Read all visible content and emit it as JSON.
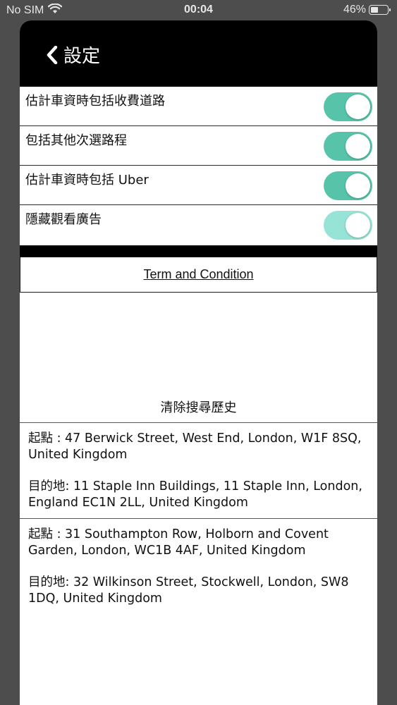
{
  "status_bar": {
    "carrier": "No SIM",
    "time": "00:04",
    "battery_percent": "46%",
    "battery_level": 0.46
  },
  "header": {
    "back_label": "設定"
  },
  "settings": [
    {
      "label": "估計車資時包括收費道路",
      "on": true
    },
    {
      "label": "包括其他次選路程",
      "on": true
    },
    {
      "label": "估計車資時包括 Uber",
      "on": true
    },
    {
      "label": "隱藏觀看廣告",
      "on": true
    }
  ],
  "terms": {
    "label": "Term and Condition"
  },
  "history": {
    "clear_label": "清除搜尋歷史",
    "items": [
      {
        "origin": "起點 : 47 Berwick Street, West End, London, W1F 8SQ, United Kingdom",
        "destination": "目的地: 11 Staple Inn Buildings, 11 Staple Inn, London, England EC1N 2LL, United Kingdom"
      },
      {
        "origin": "起點 : 31 Southampton Row, Holborn and Covent Garden, London, WC1B 4AF, United Kingdom",
        "destination": "目的地: 32 Wilkinson Street, Stockwell, London, SW8 1DQ, United Kingdom"
      }
    ]
  },
  "colors": {
    "toggle_on": "#57c4aa",
    "toggle_dim": "#96e4d5",
    "header_bg": "#000000"
  }
}
